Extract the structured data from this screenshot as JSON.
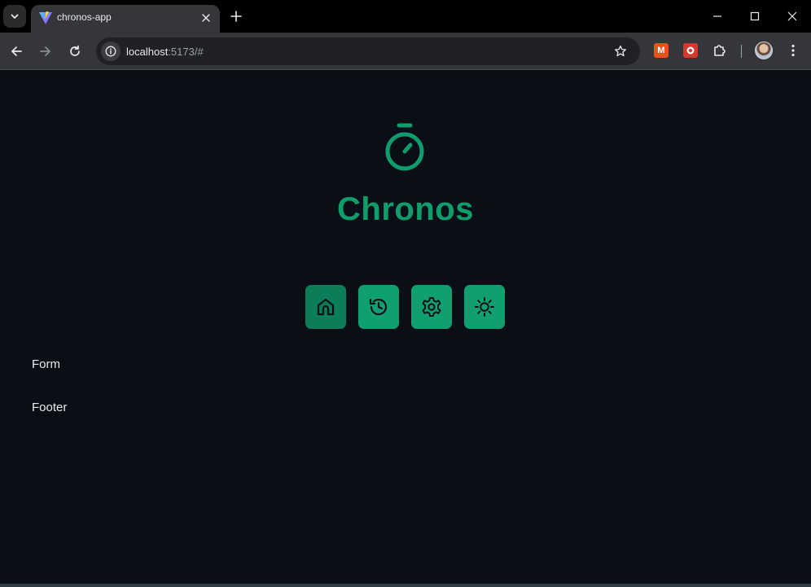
{
  "browser": {
    "tab": {
      "title": "chronos-app"
    },
    "address_bar": {
      "host": "localhost",
      "rest": ":5173/#"
    },
    "extensions": {
      "m_label": "M"
    }
  },
  "app": {
    "title": "Chronos",
    "accent_color": "#0f9d6b",
    "logo_icon": "stopwatch-icon",
    "nav_buttons": [
      {
        "icon": "home-icon",
        "active": true
      },
      {
        "icon": "history-icon",
        "active": false
      },
      {
        "icon": "gear-icon",
        "active": false
      },
      {
        "icon": "sun-icon",
        "active": false
      }
    ],
    "sections": {
      "form": "Form",
      "footer": "Footer"
    }
  }
}
